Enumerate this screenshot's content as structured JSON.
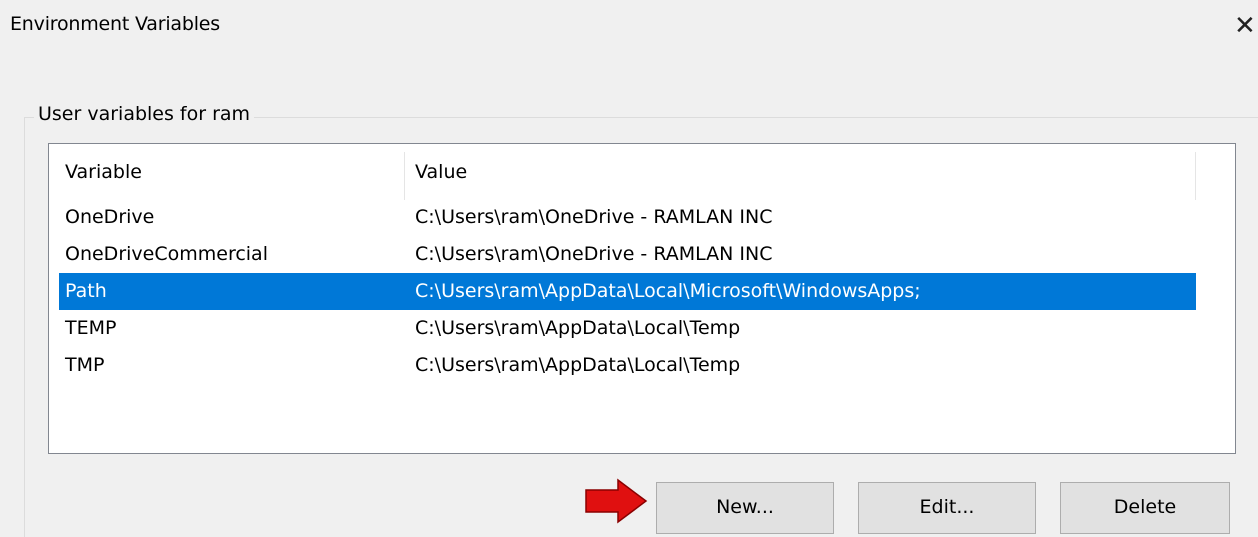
{
  "dialog": {
    "title": "Environment Variables",
    "close_glyph": "✕"
  },
  "user_group": {
    "label": "User variables for ram",
    "columns": [
      "Variable",
      "Value"
    ],
    "rows": [
      {
        "variable": "OneDrive",
        "value": "C:\\Users\\ram\\OneDrive - RAMLAN INC",
        "selected": false
      },
      {
        "variable": "OneDriveCommercial",
        "value": "C:\\Users\\ram\\OneDrive - RAMLAN INC",
        "selected": false
      },
      {
        "variable": "Path",
        "value": "C:\\Users\\ram\\AppData\\Local\\Microsoft\\WindowsApps;",
        "selected": true
      },
      {
        "variable": "TEMP",
        "value": "C:\\Users\\ram\\AppData\\Local\\Temp",
        "selected": false
      },
      {
        "variable": "TMP",
        "value": "C:\\Users\\ram\\AppData\\Local\\Temp",
        "selected": false
      }
    ],
    "buttons": {
      "new_label": "New...",
      "edit_label": "Edit...",
      "delete_label": "Delete"
    }
  },
  "colors": {
    "selection": "#0078d7",
    "pointer_arrow": "#e01010"
  },
  "annotation": {
    "icon": "right-arrow-icon"
  }
}
